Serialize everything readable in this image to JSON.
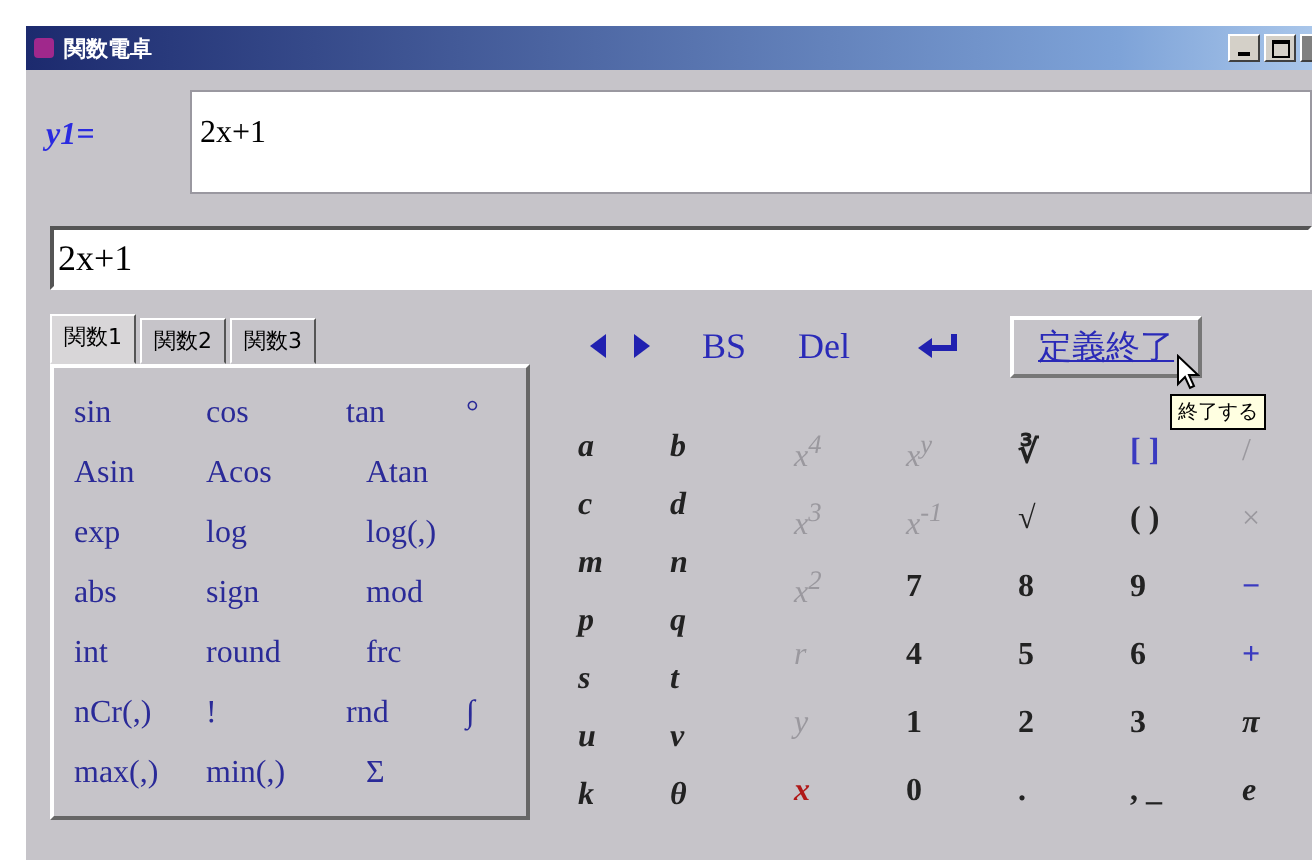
{
  "window": {
    "title": "関数電卓"
  },
  "definition": {
    "label": "y1=",
    "value": "2x+1"
  },
  "input": {
    "value": "2x+1"
  },
  "tabs": [
    {
      "label": "関数1",
      "selected": true
    },
    {
      "label": "関数2",
      "selected": false
    },
    {
      "label": "関数3",
      "selected": false
    }
  ],
  "functions": [
    [
      "sin",
      "cos",
      "tan",
      "°"
    ],
    [
      "Asin",
      "Acos",
      "Atan"
    ],
    [
      "exp",
      "log",
      "log(,)"
    ],
    [
      "abs",
      "sign",
      "mod"
    ],
    [
      "int",
      "round",
      "frc"
    ],
    [
      "nCr(,)",
      "!",
      "rnd",
      "∫"
    ],
    [
      "max(,)",
      "min(,)",
      "Σ"
    ]
  ],
  "toolbar": {
    "buttons": [
      {
        "kind": "left"
      },
      {
        "kind": "right"
      },
      {
        "kind": "text",
        "label": "BS"
      },
      {
        "kind": "text",
        "label": "Del"
      },
      {
        "kind": "enter"
      }
    ],
    "finish": {
      "label": "定義終了",
      "hovered": true
    },
    "tooltip": "終了する"
  },
  "variables": [
    "a",
    "b",
    "c",
    "d",
    "m",
    "n",
    "p",
    "q",
    "s",
    "t",
    "u",
    "v",
    "k",
    "θ"
  ],
  "keys": [
    {
      "text": "x$^{4}$",
      "kind": "var",
      "disabled": true
    },
    {
      "text": "x$^{y}$",
      "kind": "var",
      "disabled": true
    },
    {
      "text": "∛",
      "kind": "num",
      "disabled": false
    },
    {
      "text": "[ ]",
      "kind": "op",
      "disabled": false
    },
    {
      "text": "/",
      "kind": "op",
      "disabled": true
    },
    {
      "text": "x$^{3}$",
      "kind": "var",
      "disabled": true
    },
    {
      "text": "x$^{-1}$",
      "kind": "var",
      "disabled": true
    },
    {
      "text": "√",
      "kind": "num",
      "disabled": false
    },
    {
      "text": "( )",
      "kind": "num",
      "disabled": false
    },
    {
      "text": "×",
      "kind": "op",
      "disabled": true
    },
    {
      "text": "x$^{2}$",
      "kind": "var",
      "disabled": true
    },
    {
      "text": "7",
      "kind": "num",
      "disabled": false
    },
    {
      "text": "8",
      "kind": "num",
      "disabled": false
    },
    {
      "text": "9",
      "kind": "num",
      "disabled": false
    },
    {
      "text": "−",
      "kind": "op",
      "disabled": false
    },
    {
      "text": "r",
      "kind": "var",
      "disabled": true
    },
    {
      "text": "4",
      "kind": "num",
      "disabled": false
    },
    {
      "text": "5",
      "kind": "num",
      "disabled": false
    },
    {
      "text": "6",
      "kind": "num",
      "disabled": false
    },
    {
      "text": "+",
      "kind": "op",
      "disabled": false
    },
    {
      "text": "y",
      "kind": "var",
      "disabled": true
    },
    {
      "text": "1",
      "kind": "num",
      "disabled": false
    },
    {
      "text": "2",
      "kind": "num",
      "disabled": false
    },
    {
      "text": "3",
      "kind": "num",
      "disabled": false
    },
    {
      "text": "π",
      "kind": "var",
      "disabled": false
    },
    {
      "text": "x",
      "kind": "current",
      "disabled": false
    },
    {
      "text": "0",
      "kind": "num",
      "disabled": false
    },
    {
      "text": ".",
      "kind": "num",
      "disabled": false
    },
    {
      "text": ", _",
      "kind": "num",
      "disabled": false
    },
    {
      "text": "e",
      "kind": "var",
      "disabled": false
    }
  ]
}
